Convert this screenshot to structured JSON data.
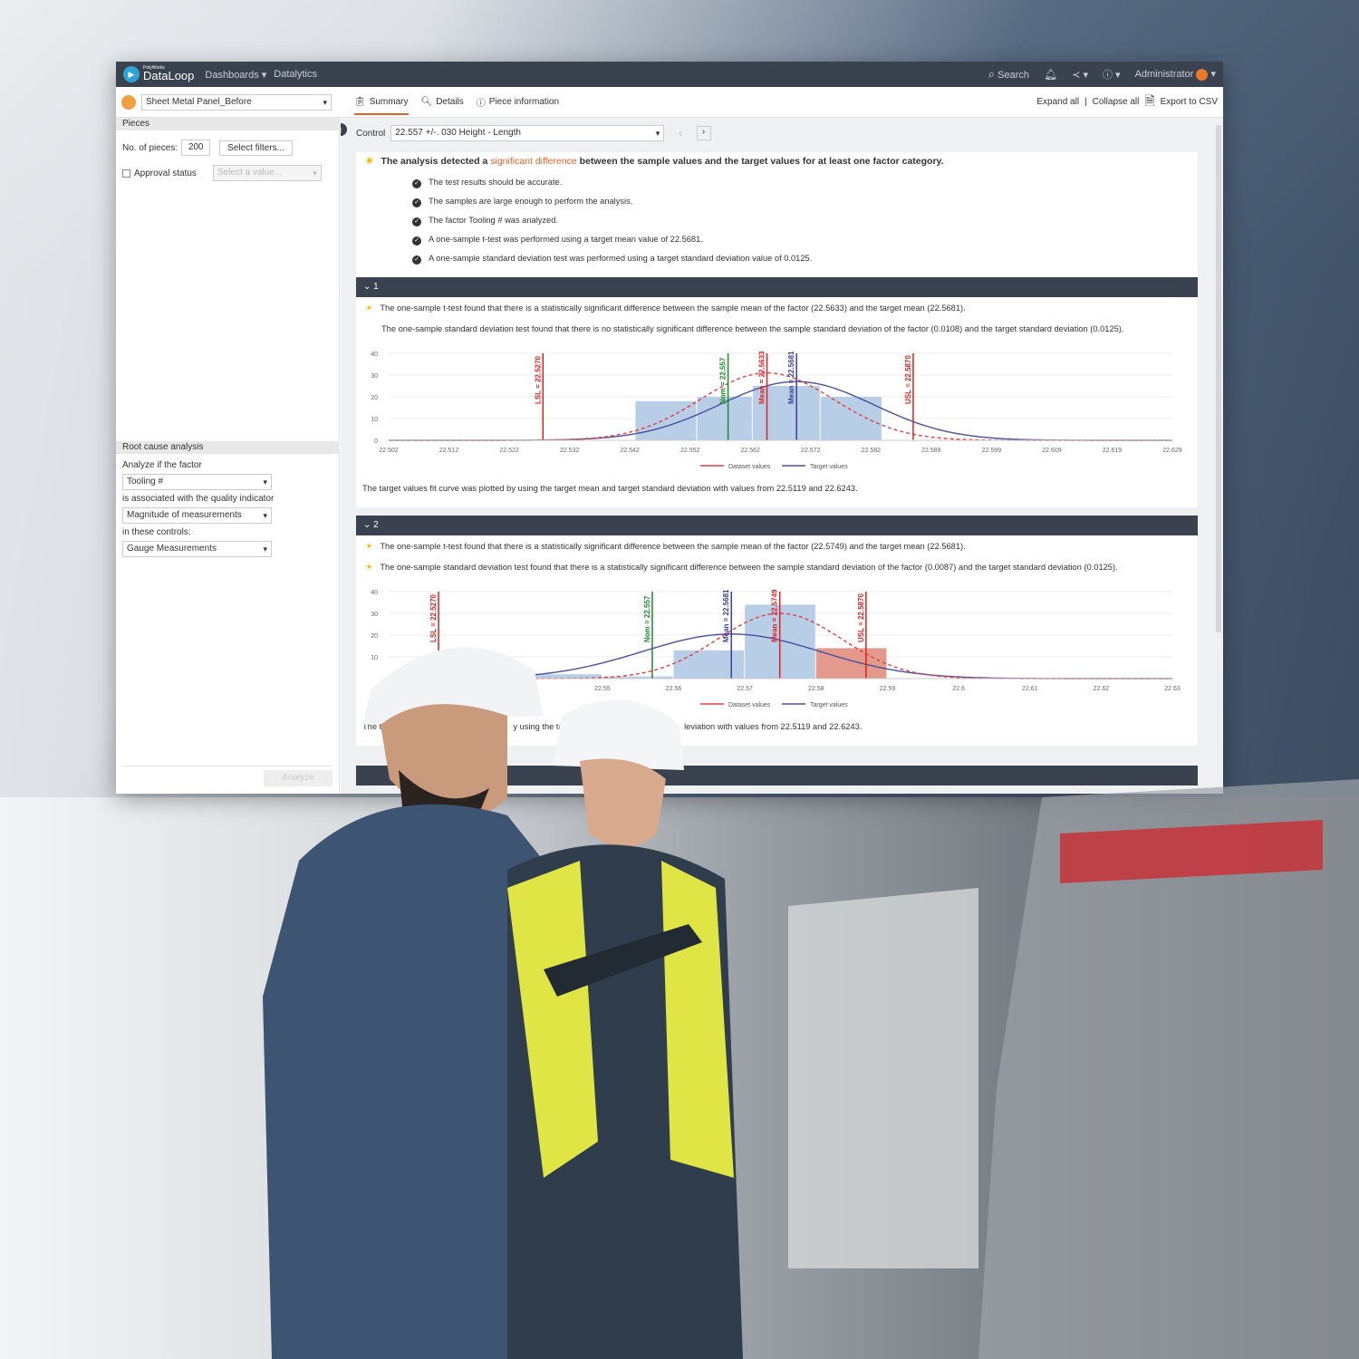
{
  "header": {
    "brand_small": "PolyWorks",
    "brand": "DataLoop",
    "nav": [
      "Dashboards ▾",
      "Datalytics"
    ],
    "search": "Search",
    "user": "Administrator"
  },
  "toolbar": {
    "project": "Sheet Metal Panel_Before",
    "tabs": [
      "Summary",
      "Details",
      "Piece information"
    ],
    "expand": "Expand all",
    "collapse": "Collapse all",
    "export": "Export to CSV"
  },
  "sidebar": {
    "pieces_title": "Pieces",
    "no_pieces_label": "No. of pieces:",
    "no_pieces": "200",
    "select_filters": "Select filters...",
    "approval": "Approval status",
    "approval_placeholder": "Select a value...",
    "rca_title": "Root cause analysis",
    "analyze_label": "Analyze if the factor",
    "factor": "Tooling #",
    "assoc_label": "is associated with the quality indicator",
    "indicator": "Magnitude of measurements",
    "controls_label": "in these controls:",
    "controls": "Gauge Measurements",
    "analyze_btn": "Analyze"
  },
  "control": {
    "label": "Control",
    "value": "22.557 +/-. 030 Height - Length"
  },
  "summary": {
    "pre": "The analysis detected a ",
    "highlight": "significant difference",
    "post": " between the sample values and the target values for at least one factor category.",
    "highlight_color": "#e0622a",
    "checks": [
      "The test results should be accurate.",
      "The samples are large enough to perform the analysis.",
      "The factor Tooling # was analyzed.",
      "A one-sample t-test was performed using a target mean value of 22.5681.",
      "A one-sample standard deviation test was performed using a target standard deviation value of 0.0125."
    ]
  },
  "sections": [
    {
      "title": "1",
      "findings": [
        "The one-sample t-test found that there is a statistically significant difference between the sample mean of the factor (22.5633) and the target mean (22.5681).",
        "The one-sample standard deviation test found that there is no statistically significant difference between the sample standard deviation of the factor (0.0108) and the target standard deviation (0.0125)."
      ],
      "footer": "The target values fit curve was plotted by using the target mean and target standard deviation with values from 22.5119 and 22.6243."
    },
    {
      "title": "2",
      "findings": [
        "The one-sample t-test found that there is a statistically significant difference between the sample mean of the factor (22.5749) and the target mean (22.5681).",
        "The one-sample standard deviation test found that there is a statistically significant difference between the sample standard deviation of the factor (0.0087) and the target standard deviation (0.0125)."
      ],
      "footer_a": "The ta",
      "footer_b": "y using the targe",
      "footer_c": "leviation with values from 22.5119 and 22.6243."
    }
  ],
  "chart_data": [
    {
      "type": "bar",
      "xlim": [
        22.502,
        22.629
      ],
      "ylim": [
        0,
        40
      ],
      "yticks": [
        "0",
        "10",
        "20",
        "30",
        "40"
      ],
      "xticks": [
        "22.502",
        "22.512",
        "22.522",
        "22.532",
        "22.542",
        "22.552",
        "22.562",
        "22.572",
        "22.582",
        "22.589",
        "22.599",
        "22.609",
        "22.619",
        "22.629"
      ],
      "bins": [
        {
          "from": 22.542,
          "to": 22.552,
          "value": 18,
          "color": "#b8cde6"
        },
        {
          "from": 22.552,
          "to": 22.561,
          "value": 20,
          "color": "#b8cde6"
        },
        {
          "from": 22.561,
          "to": 22.572,
          "value": 25,
          "color": "#b8cde6"
        },
        {
          "from": 22.572,
          "to": 22.582,
          "value": 20,
          "color": "#b8cde6"
        }
      ],
      "vlines": [
        {
          "label": "LSL = 22.5270",
          "x": 22.527,
          "color": "#e02020"
        },
        {
          "label": "Nom = 22.557",
          "x": 22.557,
          "color": "#1a8a2a"
        },
        {
          "label": "Mean = 22.5633",
          "x": 22.5633,
          "color": "#e02020"
        },
        {
          "label": "Mean = 22.5681",
          "x": 22.5681,
          "color": "#3a3f9a"
        },
        {
          "label": "USL = 22.5870",
          "x": 22.587,
          "color": "#e02020"
        }
      ],
      "curves": [
        {
          "name": "Dataset values",
          "mean": 22.5633,
          "sd": 0.0108,
          "peak": 31,
          "color": "#e04040",
          "dashed": true
        },
        {
          "name": "Target values",
          "mean": 22.5681,
          "sd": 0.0125,
          "peak": 27,
          "color": "#4a4fa0",
          "dashed": false
        }
      ],
      "legend": "bottom"
    },
    {
      "type": "bar",
      "xlim": [
        22.52,
        22.63
      ],
      "ylim": [
        0,
        40
      ],
      "yticks": [
        "",
        "10",
        "20",
        "30",
        "40"
      ],
      "xticks": [
        "",
        "22.53",
        "",
        "22.55",
        "22.56",
        "22.57",
        "22.58",
        "22.59",
        "22.6",
        "22.61",
        "22.62",
        "22.63"
      ],
      "bins": [
        {
          "from": 22.54,
          "to": 22.55,
          "value": 2,
          "color": "#b8cde6"
        },
        {
          "from": 22.55,
          "to": 22.56,
          "value": 1,
          "color": "#b8cde6"
        },
        {
          "from": 22.56,
          "to": 22.57,
          "value": 13,
          "color": "#b8cde6"
        },
        {
          "from": 22.57,
          "to": 22.58,
          "value": 34,
          "color": "#b8cde6"
        },
        {
          "from": 22.58,
          "to": 22.59,
          "value": 14,
          "color": "#e39a8c"
        }
      ],
      "vlines": [
        {
          "label": "LSL = 22.5270",
          "x": 22.527,
          "color": "#e02020"
        },
        {
          "label": "Nom = 22.557",
          "x": 22.557,
          "color": "#1a8a2a"
        },
        {
          "label": "Mean = 22.5681",
          "x": 22.5681,
          "color": "#3a3f9a"
        },
        {
          "label": "Mean = 22.5749",
          "x": 22.5749,
          "color": "#e02020"
        },
        {
          "label": "USL = 22.5870",
          "x": 22.587,
          "color": "#e02020"
        }
      ],
      "curves": [
        {
          "name": "Dataset values",
          "mean": 22.5749,
          "sd": 0.0087,
          "peak": 30,
          "color": "#e04040",
          "dashed": true
        },
        {
          "name": "Target values",
          "mean": 22.5681,
          "sd": 0.0125,
          "peak": 20.5,
          "color": "#4a4fa0",
          "dashed": false
        }
      ],
      "legend": "bottom"
    }
  ]
}
